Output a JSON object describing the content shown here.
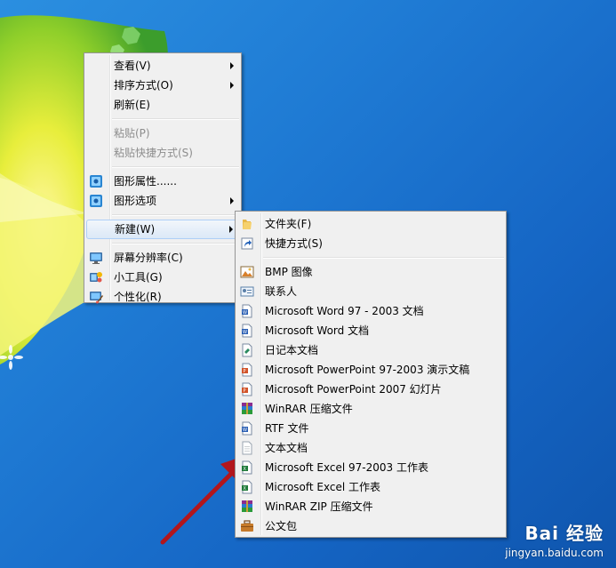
{
  "desktop_menu": {
    "items": [
      {
        "label": "查看(V)",
        "submenu": true,
        "disabled": false,
        "icon": null
      },
      {
        "label": "排序方式(O)",
        "submenu": true,
        "disabled": false,
        "icon": null
      },
      {
        "label": "刷新(E)",
        "submenu": false,
        "disabled": false,
        "icon": null
      },
      {
        "label": "粘贴(P)",
        "submenu": false,
        "disabled": true,
        "icon": null
      },
      {
        "label": "粘贴快捷方式(S)",
        "submenu": false,
        "disabled": true,
        "icon": null
      },
      {
        "label": "图形属性......",
        "submenu": false,
        "disabled": false,
        "icon": "graphics-properties-icon"
      },
      {
        "label": "图形选项",
        "submenu": true,
        "disabled": false,
        "icon": "graphics-options-icon"
      },
      {
        "label": "新建(W)",
        "submenu": true,
        "disabled": false,
        "icon": null,
        "highlighted": true
      },
      {
        "label": "屏幕分辨率(C)",
        "submenu": false,
        "disabled": false,
        "icon": "screen-resolution-icon"
      },
      {
        "label": "小工具(G)",
        "submenu": false,
        "disabled": false,
        "icon": "gadgets-icon"
      },
      {
        "label": "个性化(R)",
        "submenu": false,
        "disabled": false,
        "icon": "personalize-icon"
      }
    ]
  },
  "new_submenu": {
    "items": [
      {
        "label": "文件夹(F)",
        "icon": "folder-icon"
      },
      {
        "label": "快捷方式(S)",
        "icon": "shortcut-icon"
      },
      {
        "label": "BMP 图像",
        "icon": "bmp-image-icon"
      },
      {
        "label": "联系人",
        "icon": "contact-icon"
      },
      {
        "label": "Microsoft Word 97 - 2003 文档",
        "icon": "word-97-icon"
      },
      {
        "label": "Microsoft Word 文档",
        "icon": "word-doc-icon"
      },
      {
        "label": "日记本文档",
        "icon": "journal-icon"
      },
      {
        "label": "Microsoft PowerPoint 97-2003 演示文稿",
        "icon": "powerpoint-97-icon"
      },
      {
        "label": "Microsoft PowerPoint 2007 幻灯片",
        "icon": "powerpoint-2007-icon"
      },
      {
        "label": "WinRAR 压缩文件",
        "icon": "winrar-icon"
      },
      {
        "label": "RTF 文件",
        "icon": "rtf-icon"
      },
      {
        "label": "文本文档",
        "icon": "text-document-icon"
      },
      {
        "label": "Microsoft Excel 97-2003 工作表",
        "icon": "excel-97-icon"
      },
      {
        "label": "Microsoft Excel 工作表",
        "icon": "excel-icon"
      },
      {
        "label": "WinRAR ZIP 压缩文件",
        "icon": "winrar-zip-icon"
      },
      {
        "label": "公文包",
        "icon": "briefcase-icon"
      }
    ]
  },
  "watermark": {
    "top": "Bai 经验",
    "bottom": "jingyan.baidu.com"
  },
  "colors": {
    "desktop_blue": "#1f7bd4",
    "menu_bg": "#f0f0f0",
    "highlight_border": "#aecff7",
    "arrow_red": "#b2161c"
  }
}
